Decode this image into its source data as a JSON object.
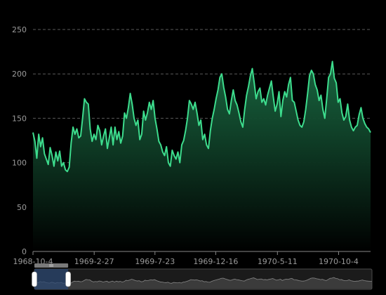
{
  "chart_data": {
    "type": "area",
    "x_start": "1968-10-4",
    "x_end": "1970-12-1",
    "x_ticks": [
      "1968-10-4",
      "1969-2-27",
      "1969-7-23",
      "1969-12-16",
      "1970-5-11",
      "1970-10-4"
    ],
    "ylim": [
      0,
      250
    ],
    "y_ticks": [
      0,
      50,
      100,
      150,
      200,
      250
    ],
    "grid": true,
    "legend": "none",
    "series": [
      {
        "values": [
          134,
          124,
          105,
          132,
          118,
          128,
          110,
          104,
          98,
          117,
          108,
          96,
          112,
          102,
          113,
          96,
          100,
          92,
          90,
          95,
          122,
          140,
          132,
          138,
          128,
          130,
          150,
          172,
          168,
          166,
          138,
          124,
          132,
          126,
          142,
          136,
          120,
          130,
          138,
          116,
          128,
          140,
          120,
          140,
          126,
          135,
          122,
          130,
          156,
          150,
          162,
          178,
          166,
          150,
          142,
          148,
          126,
          132,
          158,
          148,
          156,
          168,
          160,
          170,
          150,
          138,
          124,
          120,
          112,
          108,
          118,
          100,
          96,
          114,
          108,
          104,
          112,
          100,
          120,
          125,
          136,
          150,
          170,
          166,
          160,
          168,
          156,
          142,
          148,
          126,
          132,
          120,
          116,
          136,
          150,
          160,
          172,
          182,
          196,
          200,
          185,
          174,
          160,
          155,
          170,
          182,
          170,
          165,
          156,
          146,
          140,
          160,
          176,
          186,
          198,
          206,
          190,
          172,
          180,
          184,
          168,
          172,
          165,
          176,
          184,
          192,
          174,
          158,
          166,
          180,
          152,
          170,
          180,
          174,
          188,
          196,
          170,
          168,
          158,
          148,
          142,
          140,
          146,
          160,
          178,
          198,
          204,
          200,
          188,
          182,
          170,
          176,
          160,
          150,
          172,
          196,
          200,
          214,
          195,
          190,
          168,
          172,
          156,
          148,
          152,
          166,
          148,
          140,
          136,
          140,
          142,
          154,
          162,
          150,
          144,
          140,
          138,
          134
        ]
      }
    ],
    "colors": {
      "line": "#3ddc8d",
      "area_top": "#1a6b43",
      "area_bottom": "#000000",
      "grid": "#5a5a5a",
      "axis": "#888888",
      "label": "#9a9a9a",
      "zoom_track": "#1b1b1b",
      "zoom_selection": "#2b4770",
      "zoom_handle": "#ffffff",
      "zoom_area": "#555555"
    },
    "dataZoom": {
      "start": 0.0,
      "end": 0.1,
      "handle_icon": "grip-handle-icon"
    }
  }
}
